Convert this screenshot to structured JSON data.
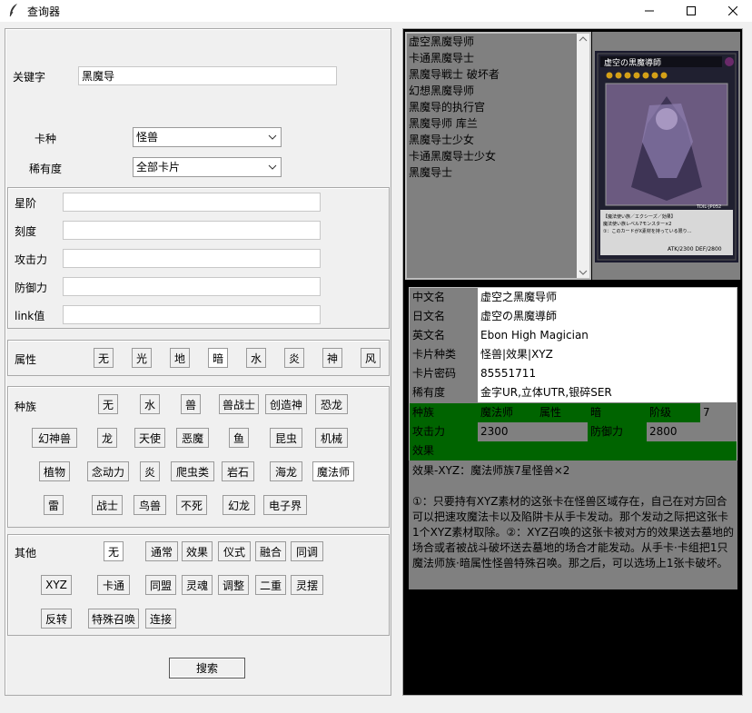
{
  "window": {
    "title": "查询器",
    "minimize_icon": "minimize-icon",
    "maximize_icon": "maximize-icon",
    "close_icon": "close-icon"
  },
  "search": {
    "keyword_label": "关键字",
    "keyword_value": "黑魔导",
    "card_type_label": "卡种",
    "card_type_value": "怪兽",
    "rarity_label": "稀有度",
    "rarity_value": "全部卡片"
  },
  "stats": {
    "level_label": "星阶",
    "scale_label": "刻度",
    "atk_label": "攻击力",
    "def_label": "防御力",
    "link_label": "link值"
  },
  "attribute": {
    "label": "属性",
    "options": [
      "无",
      "光",
      "地",
      "暗",
      "水",
      "炎",
      "神",
      "风"
    ],
    "selected": "暗"
  },
  "race": {
    "label": "种族",
    "options": [
      "无",
      "水",
      "兽",
      "兽战士",
      "创造神",
      "恐龙",
      "幻神兽",
      "龙",
      "天使",
      "恶魔",
      "鱼",
      "昆虫",
      "机械",
      "植物",
      "念动力",
      "炎",
      "爬虫类",
      "岩石",
      "海龙",
      "魔法师",
      "雷",
      "战士",
      "鸟兽",
      "不死",
      "幻龙",
      "电子界"
    ],
    "selected": "魔法师"
  },
  "other": {
    "label": "其他",
    "options": [
      "无",
      "通常",
      "效果",
      "仪式",
      "融合",
      "同调",
      "XYZ",
      "卡通",
      "同盟",
      "灵魂",
      "调整",
      "二重",
      "灵摆",
      "反转",
      "特殊召唤",
      "连接"
    ],
    "selected": "无"
  },
  "search_button": "搜索",
  "results": [
    "虚空黑魔导师",
    "卡通黑魔导士",
    "黑魔导戦士 破坏者",
    "幻想黑魔导师",
    "黑魔导的执行官",
    "黑魔导师 库兰",
    "黑魔导士少女",
    "卡通黑魔导士少女",
    "黑魔导士"
  ],
  "card_image": {
    "name_jp": "虚空の黒魔導師",
    "atk_def_text": "ATK/2300  DEF/2800",
    "code": "TDIL-JP052",
    "text_jp": "【魔法使い族／エクシーズ／効果】\n魔法使い族レベル7モンスター×2\n①：このカードがX素材を持っている限り、自分は速攻魔法カード及び罠カードを手札から発動できる。",
    "colors": {
      "frame": "#1a1a2e",
      "art": "#7b6a8e",
      "stars": "#d4a017"
    }
  },
  "info": {
    "cn_name_label": "中文名",
    "cn_name": "虚空之黑魔导师",
    "jp_name_label": "日文名",
    "jp_name": "虚空の黒魔導師",
    "en_name_label": "英文名",
    "en_name": "Ebon High Magician",
    "type_label": "卡片种类",
    "type": "怪兽|效果|XYZ",
    "password_label": "卡片密码",
    "password": "85551711",
    "rarity_label": "稀有度",
    "rarity": "金字UR,立体UTR,银碎SER",
    "race_label": "种族",
    "race": "魔法师",
    "attr_label": "属性",
    "attr": "暗",
    "rank_label": "阶级",
    "rank": "7",
    "atk_label": "攻击力",
    "atk": "2300",
    "def_label": "防御力",
    "def": "2800",
    "effect_label": "效果",
    "effect_text": "效果-XYZ：魔法师族7星怪兽×2\n\n①：只要持有XYZ素材的这张卡在怪兽区域存在，自己在对方回合可以把速攻魔法卡以及陷阱卡从手卡发动。那个发动之际把这张卡1个XYZ素材取除。②：XYZ召唤的这张卡被对方的效果送去墓地的场合或者被战斗破坏送去墓地的场合才能发动。从手卡·卡组把1只魔法师族·暗属性怪兽特殊召唤。那之后，可以选场上1张卡破坏。"
  },
  "colors": {
    "green": "#006400",
    "gray": "#808080",
    "black": "#000000"
  }
}
